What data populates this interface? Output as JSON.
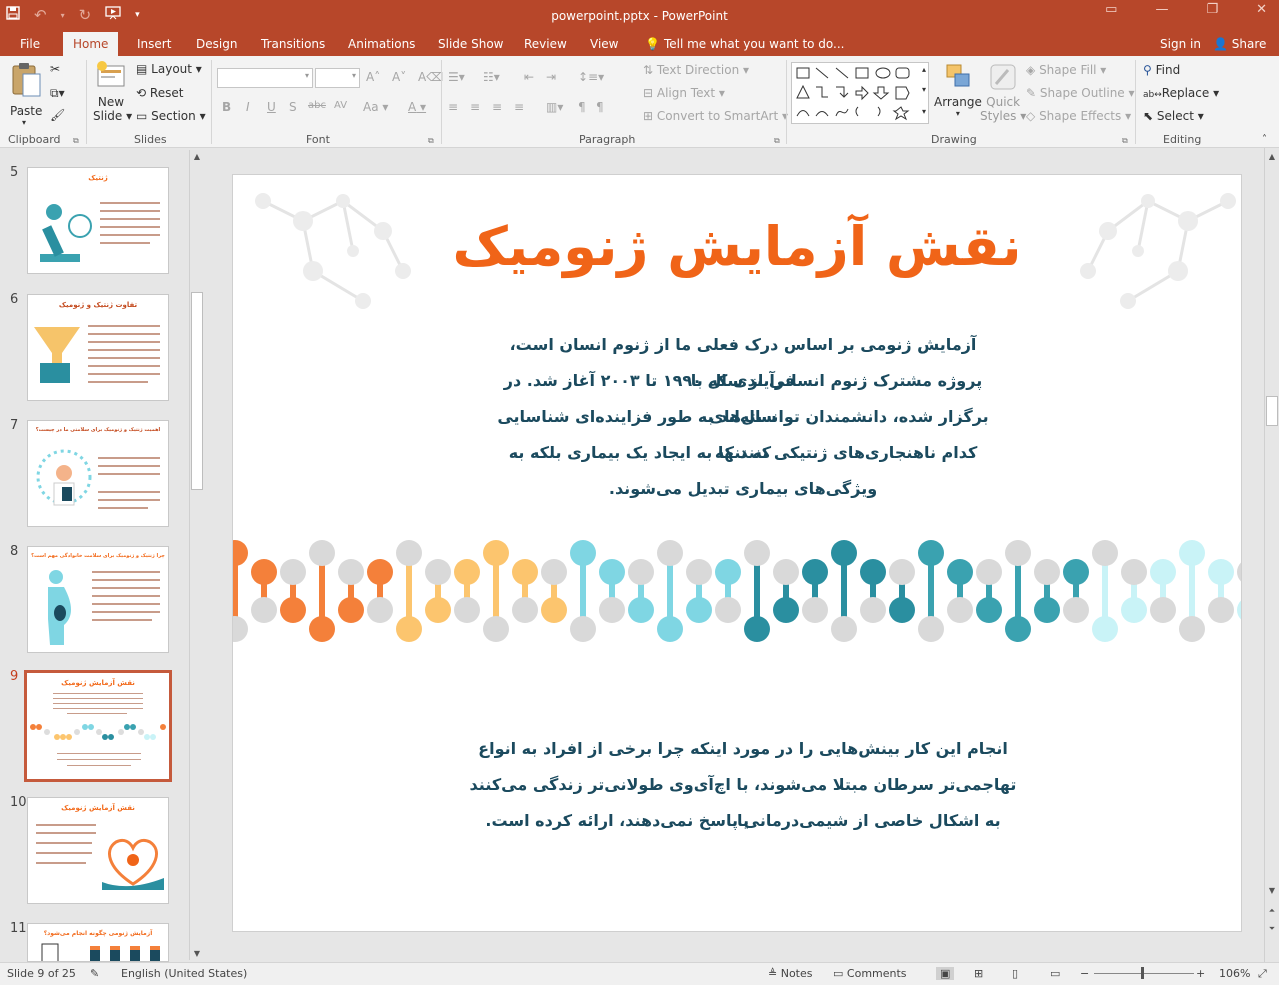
{
  "window": {
    "title": "powerpoint.pptx - PowerPoint",
    "controls": [
      "ribbon-options",
      "minimize",
      "restore",
      "close"
    ]
  },
  "tabs": [
    "File",
    "Home",
    "Insert",
    "Design",
    "Transitions",
    "Animations",
    "Slide Show",
    "Review",
    "View"
  ],
  "active_tab": "Home",
  "tell_me": "Tell me what you want to do...",
  "account": {
    "sign_in": "Sign in",
    "share": "Share"
  },
  "ribbon": {
    "clipboard": {
      "label": "Clipboard",
      "paste": "Paste"
    },
    "slides": {
      "label": "Slides",
      "new_slide_line1": "New",
      "new_slide_line2": "Slide",
      "layout": "Layout",
      "reset": "Reset",
      "section": "Section"
    },
    "font": {
      "label": "Font",
      "bold": "B",
      "italic": "I",
      "underline": "U",
      "shadow": "S",
      "strike": "abc",
      "spacing": "AV",
      "case": "Aa",
      "color": "A"
    },
    "paragraph": {
      "label": "Paragraph",
      "text_direction": "Text Direction",
      "align_text": "Align Text",
      "convert_smartart": "Convert to SmartArt"
    },
    "drawing": {
      "label": "Drawing",
      "arrange": "Arrange",
      "quick_styles_line1": "Quick",
      "quick_styles_line2": "Styles",
      "shape_fill": "Shape Fill",
      "shape_outline": "Shape Outline",
      "shape_effects": "Shape Effects"
    },
    "editing": {
      "label": "Editing",
      "find": "Find",
      "replace": "Replace",
      "select": "Select"
    }
  },
  "thumbnails": [
    {
      "num": "5",
      "title": "ژنتیک"
    },
    {
      "num": "6",
      "title": "تفاوت ژنتیک و ژنومیک"
    },
    {
      "num": "7",
      "title": "اهمیت ژنتیک و ژنومیک برای سلامتی ما در چیست؟"
    },
    {
      "num": "8",
      "title": "چرا ژنتیک و ژنومیک برای سلامت خانوادگی مهم است؟"
    },
    {
      "num": "9",
      "title": "نقش آزمایش ژنومیک",
      "selected": true
    },
    {
      "num": "10",
      "title": "نقش آزمایش ژنومیک"
    },
    {
      "num": "11",
      "title": "آزمایش ژنومی چگونه انجام می‌شود؟"
    }
  ],
  "slide": {
    "title": "نقش آزمایش ژنومیک",
    "paragraph1": [
      "آزمایش ژنومی بر اساس درک فعلی ما از ژنوم انسان است، فرآیندی که با",
      "پروژه مشترک ژنوم انسانی از سال ۱۹۹۰ تا ۲۰۰۳ آغاز شد. در سال‌های",
      "برگزار شده، دانشمندان توانسته‌اند به طور فزاینده‌ای شناسایی کنند که",
      "کدام ناهنجاری‌های ژنتیکی نه تنها به ایجاد یک بیماری بلکه به",
      "ویژگی‌های بیماری تبدیل می‌شوند."
    ],
    "paragraph2": [
      "انجام این کار بینش‌هایی را در مورد اینکه چرا برخی از افراد به انواع",
      "تهاجمی‌تر سرطان مبتلا می‌شوند، با اچ‌آی‌وی طولانی‌تر زندگی می‌کنند یا",
      "به اشکال خاصی از شیمی‌درمانی پاسخ نمی‌دهند، ارائه کرده است."
    ],
    "title_color": "#f06418",
    "text_color": "#1b4a5e",
    "dna_colors": [
      "#f4803a",
      "#fcc56e",
      "#7fd6e3",
      "#2a8fa0",
      "#3aa2b0",
      "#c9f3f7",
      "#f4803a"
    ]
  },
  "status": {
    "slide_info": "Slide 9 of 25",
    "language": "English (United States)",
    "notes": "Notes",
    "comments": "Comments",
    "zoom": "106%"
  }
}
